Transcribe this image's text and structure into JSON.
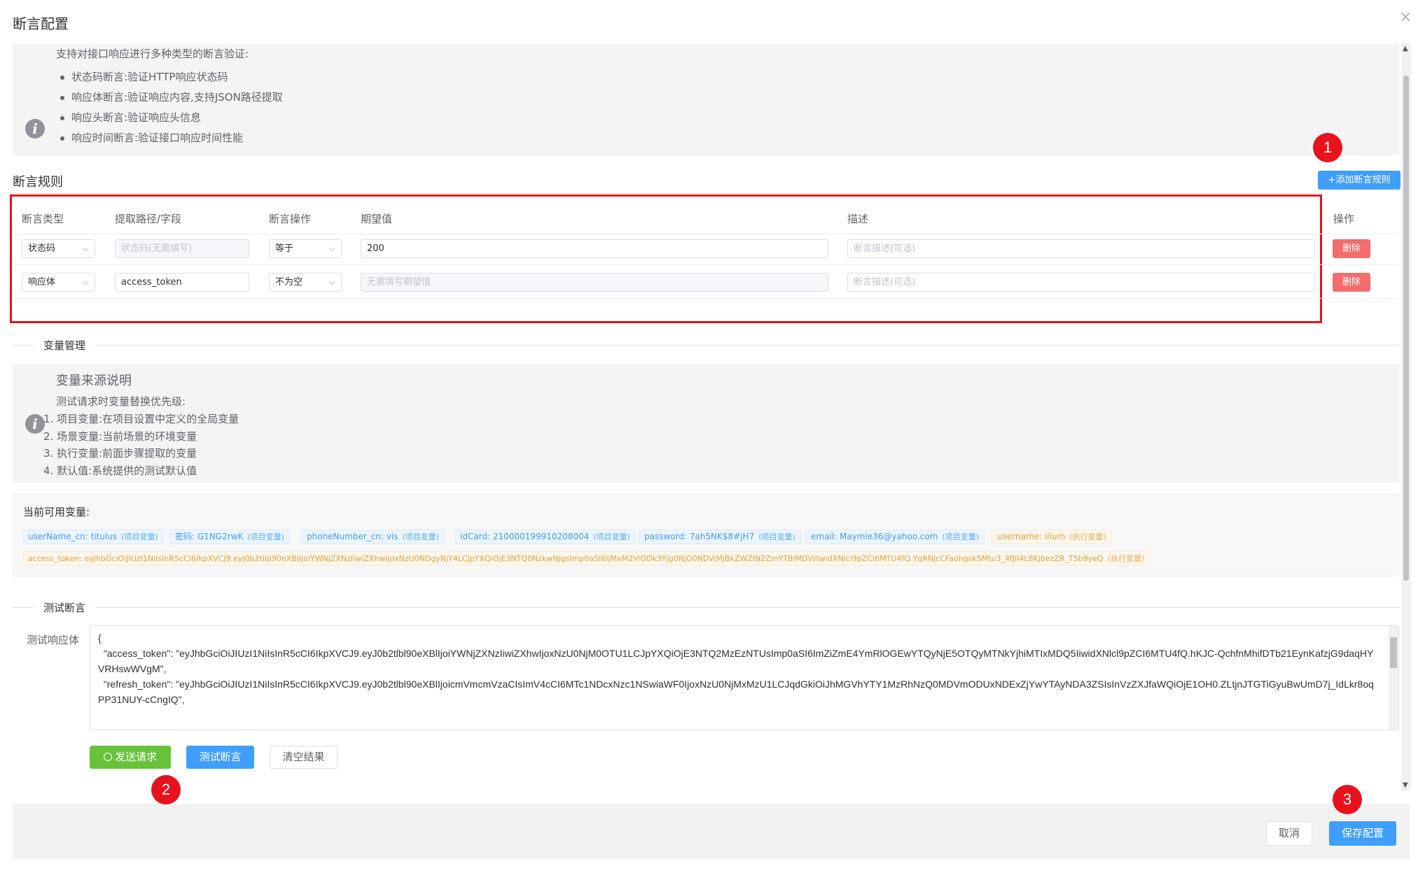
{
  "dialog": {
    "title": "断言配置",
    "close": "×"
  },
  "info1": {
    "heading": "支持对接口响应进行多种类型的断言验证:",
    "items": [
      "状态码断言:验证HTTP响应状态码",
      "响应体断言:验证响应内容,支持JSON路径提取",
      "响应头断言:验证响应头信息",
      "响应时间断言:验证接口响应时间性能"
    ]
  },
  "rules": {
    "title": "断言规则",
    "add_label": "+添加断言规则",
    "headers": [
      "断言类型",
      "提取路径/字段",
      "断言操作",
      "期望值",
      "描述",
      "操作"
    ],
    "rows": [
      {
        "type": "状态码",
        "path": "状态码(无需填写)",
        "op": "等于",
        "expected": "200",
        "desc": "断言描述(可选)",
        "action": "删除"
      },
      {
        "type": "响应体",
        "path": "access_token",
        "op": "不为空",
        "expected": "无需填写期望值",
        "desc": "断言描述(可选)",
        "action": "删除"
      }
    ]
  },
  "variables": {
    "divider": "变量管理",
    "source_title": "变量来源说明",
    "source_desc": "测试请求时变量替换优先级:",
    "source_items": [
      "1. 项目变量:在项目设置中定义的全局变量",
      "2. 场景变量:当前场景的环境变量",
      "3. 执行变量:前面步骤提取的变量",
      "4. 默认值:系统提供的测试默认值"
    ],
    "available_title": "当前可用变量:",
    "tags": [
      {
        "text": "userName_cn: titulus",
        "scope": "(项目变量)",
        "color": "blue"
      },
      {
        "text": "密码: G1NG2rwK",
        "scope": "(项目变量)",
        "color": "blue"
      },
      {
        "text": "phoneNumber_cn: vis",
        "scope": "(项目变量)",
        "color": "blue"
      },
      {
        "text": "idCard: 210000199910208004",
        "scope": "(项目变量)",
        "color": "blue"
      },
      {
        "text": "password: 7ah5NK$8#jH7",
        "scope": "(项目变量)",
        "color": "blue"
      },
      {
        "text": "email: Maymie36@yahoo.com",
        "scope": "(项目变量)",
        "color": "blue"
      },
      {
        "text": "username: illum",
        "scope": "(执行变量)",
        "color": "orange"
      },
      {
        "text": "access_token: eyJhbGciOiJIUzI1NiIsInR5cCI6IkpXVCJ9.eyJ0b2tlbl90eXBlIjoiYWNjZXNzIiwiZXhwIjoxNzU0NDgyNjY4LCJpYXQiOjE3NTQ0NzkwNjgsImp0aSI6IjMxM2ViODk3Yjg0NjQ0NDViMjBkZWZlN2ZmYTBiMDViIiwidXNlcl9pZCI6MTU4fQ.YqRNjcCFaohgskSMtu3_4fJlI4L8KjbezZR_T5b9yeQ",
        "scope": "(执行变量)",
        "color": "orange"
      }
    ]
  },
  "test": {
    "divider": "测试断言",
    "body_label": "测试响应体",
    "body_text": "{\n  \"access_token\": \"eyJhbGciOiJIUzI1NiIsInR5cCI6IkpXVCJ9.eyJ0b2tlbl90eXBlIjoiYWNjZXNzIiwiZXhwIjoxNzU0NjM0OTU1LCJpYXQiOjE3NTQ2MzEzNTUsImp0aSI6ImZiZmE4YmRlOGEwYTQyNjE5OTQyMTNkYjhiMTIxMDQ5IiwidXNlcl9pZCI6MTU4fQ.hKJC-QchfnMhifDTb21EynKafzjG9daqHYVRHswWVgM\",\n  \"refresh_token\": \"eyJhbGciOiJIUzI1NiIsInR5cCI6IkpXVCJ9.eyJ0b2tlbl90eXBlIjoicmVmcmVzaCIsImV4cCI6MTc1NDcxNzc1NSwiaWF0IjoxNzU0NjMxMzU1LCJqdGkiOiJhMGVhYTY1MzRhNzQ0MDVmODUxNDExZjYwYTAyNDA3ZSIsInVzZXJfaWQiOjE1OH0.ZLtjnJTGTiGyuBwUmD7j_IdLkr8oqPP31NUY-cCngIQ\",",
    "send_label": "发送请求",
    "test_label": "测试断言",
    "clear_label": "清空结果"
  },
  "footer": {
    "cancel_label": "取消",
    "save_label": "保存配置"
  },
  "annotations": {
    "b1": "1",
    "b2": "2",
    "b3": "3"
  },
  "colors": {
    "primary": "#409eff",
    "danger": "#f56c6c",
    "success": "#67c23a",
    "highlight": "#e8121c"
  }
}
